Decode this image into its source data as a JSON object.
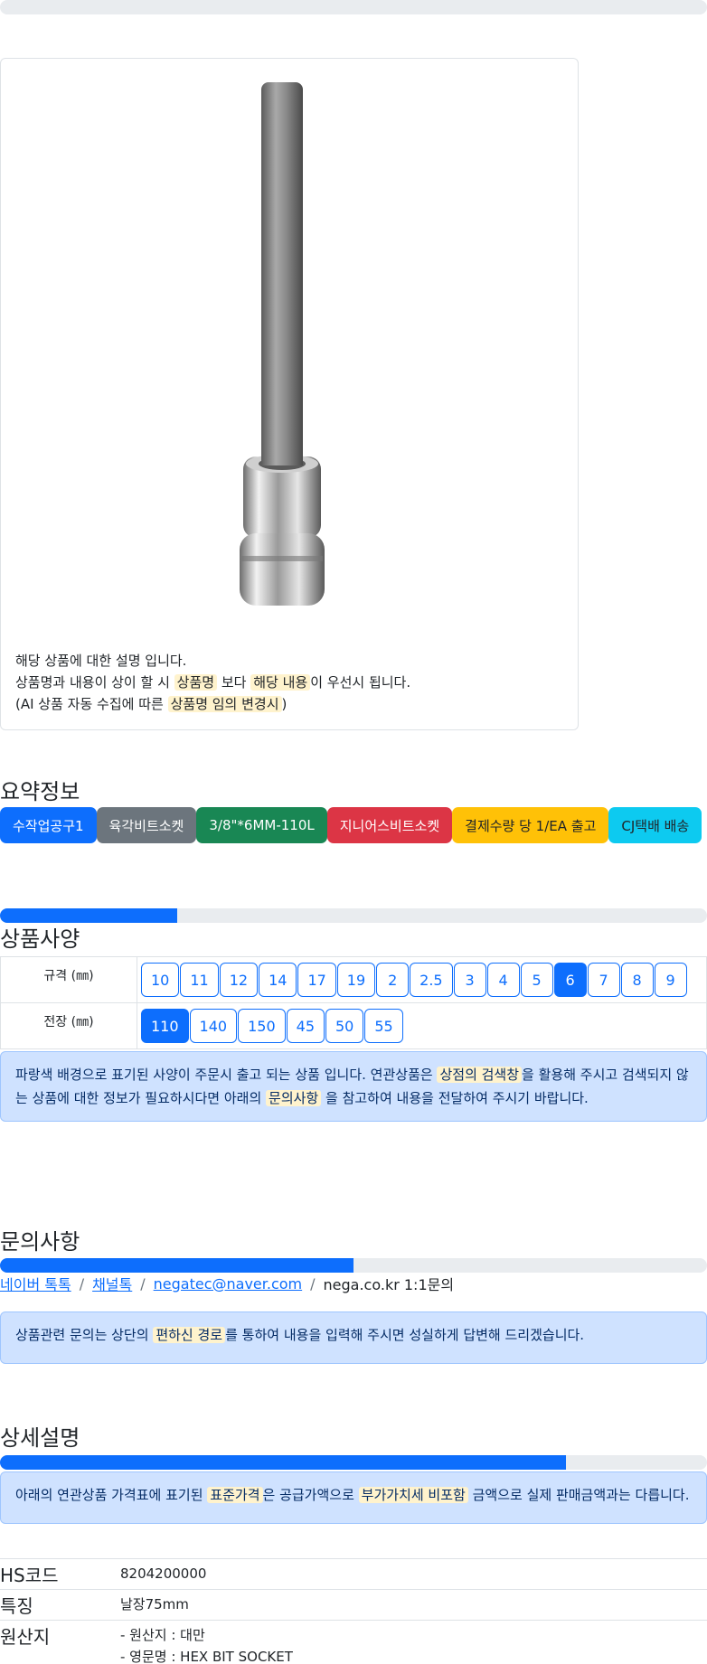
{
  "card": {
    "line1": "해당 상품에 대한 설명 입니다.",
    "line2_a": "상품명과 내용이 상이 할 시",
    "line2_hl1": "상품명",
    "line2_b": "보다",
    "line2_hl2": "해당 내용",
    "line2_c": "이 우선시 됩니다.",
    "line3_a": "(AI 상품 자동 수집에 따른",
    "line3_hl": "상품명 임의 변경시",
    "line3_b": ")"
  },
  "summary": {
    "title": "요약정보",
    "badges": [
      {
        "label": "수작업공구1",
        "color": "#0d6efd"
      },
      {
        "label": "육각비트소켓",
        "color": "#6c757d"
      },
      {
        "label": "3/8\"*6MM-110L",
        "color": "#198754"
      },
      {
        "label": "지니어스비트소켓",
        "color": "#dc3545"
      },
      {
        "label": "결제수량 당 1/EA 출고",
        "color": "#ffc107"
      },
      {
        "label": "CJ택배 배송",
        "color": "#0dcaf0"
      }
    ]
  },
  "spec": {
    "progress": 0.25,
    "title": "상품사양",
    "rows": [
      {
        "label": "규격 (㎜)",
        "options": [
          "10",
          "11",
          "12",
          "14",
          "17",
          "19",
          "2",
          "2.5",
          "3",
          "4",
          "5",
          "6",
          "7",
          "8",
          "9"
        ],
        "selected": "6"
      },
      {
        "label": "전장 (㎜)",
        "options": [
          "110",
          "140",
          "150",
          "45",
          "50",
          "55"
        ],
        "selected": "110"
      }
    ],
    "notice_a": "파랑색 배경으로 표기된 사양이 주문시 출고 되는 상품 입니다. 연관상품은",
    "notice_hl1": "상점의 검색창",
    "notice_b": "을 활용해 주시고 검색되지 않는 상품에 대한 정보가 필요하시다면 아래의",
    "notice_hl2": "문의사항",
    "notice_c": "을 참고하여 내용을 전달하여 주시기 바랍니다."
  },
  "inquiry": {
    "title": "문의사항",
    "progress": 0.5,
    "links": [
      "네이버 톡톡",
      "채널톡",
      "negatec@naver.com"
    ],
    "plain": "nega.co.kr 1:1문의",
    "notice_a": "상품관련 문의는 상단의",
    "notice_hl": "편하신 경로",
    "notice_b": "를 통하여 내용을 입력해 주시면 성실하게 답변해 드리겠습니다."
  },
  "detail": {
    "title": "상세설명",
    "progress": 0.8,
    "notice_a": "아래의 연관상품 가격표에 표기된",
    "notice_hl1": "표준가격",
    "notice_b": "은 공급가액으로",
    "notice_hl2": "부가가치세 비포함",
    "notice_c": "금액으로 실제 판매금액과는 다릅니다.",
    "rows": [
      {
        "key": "HS코드",
        "value": "8204200000"
      },
      {
        "key": "특징",
        "value": "날장75mm"
      },
      {
        "key": "원산지",
        "value": "- 원산지 : 대만",
        "value2": "- 영문명 : HEX BIT SOCKET"
      }
    ]
  }
}
